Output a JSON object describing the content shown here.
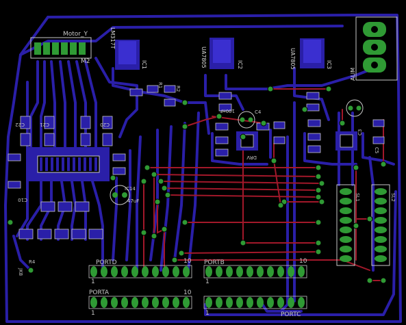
{
  "colors": {
    "background": "#000000",
    "bottom_copper": "#2a1fa8",
    "bottom_copper_light": "#3a2fd0",
    "top_copper": "#a2182a",
    "pad": "#2f9a34",
    "silk": "#c8c8c8"
  },
  "labels": {
    "motor_y": "Motor_Y",
    "m2": "M2",
    "ic1": "IC1",
    "ic2": "IC2",
    "ic3": "IC3",
    "lm317": "LM317T",
    "ua7805": "UA7805",
    "ua7805b": "UA7805",
    "alim": "ALIM",
    "c4": "C4",
    "c3": "C3",
    "c5": "C5",
    "ic14": "IC14",
    "cap47": "47uF",
    "c10": "C10",
    "c20": "C20",
    "c21": "C21",
    "c22": "C22",
    "c100nf": "100nF",
    "portd": "PORTD",
    "portb": "PORTB",
    "porta": "PORTA",
    "portc": "PORTC",
    "pin1_a": "1",
    "pin10_a": "10",
    "pin1_b": "1",
    "pin10_b": "10",
    "pin1_c": "1",
    "pin10_c": "10",
    "pin1_d": "1",
    "sl1": "SL1",
    "sl2": "SL2",
    "r1": "R1",
    "r2": "R2",
    "r4": "R4",
    "jk8": "JK8",
    "drv": "DRV"
  }
}
